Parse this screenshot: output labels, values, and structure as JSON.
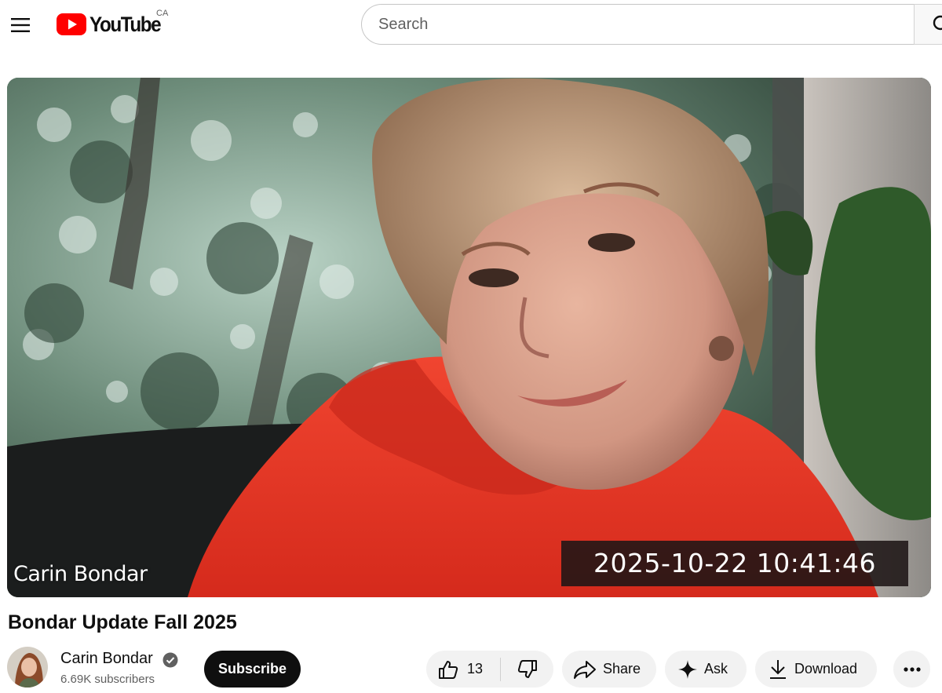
{
  "header": {
    "menu_icon": "hamburger-menu-icon",
    "logo_text": "YouTube",
    "country_code": "CA",
    "search_placeholder": "Search",
    "search_icon": "search-icon",
    "brand_red": "#ff0000"
  },
  "player": {
    "overlay_name": "Carin Bondar",
    "overlay_timestamp": "2025-10-22  10:41:46"
  },
  "video": {
    "title": "Bondar Update Fall 2025"
  },
  "channel": {
    "name": "Carin Bondar",
    "verified_icon": "verified-check-icon",
    "subscribers": "6.69K subscribers",
    "subscribe_label": "Subscribe"
  },
  "actions": {
    "like_count": "13",
    "like_icon": "thumbs-up-icon",
    "dislike_icon": "thumbs-down-icon",
    "share_label": "Share",
    "share_icon": "share-arrow-icon",
    "ask_label": "Ask",
    "ask_icon": "sparkle-icon",
    "download_label": "Download",
    "download_icon": "download-icon",
    "more_icon": "more-dots-icon"
  }
}
